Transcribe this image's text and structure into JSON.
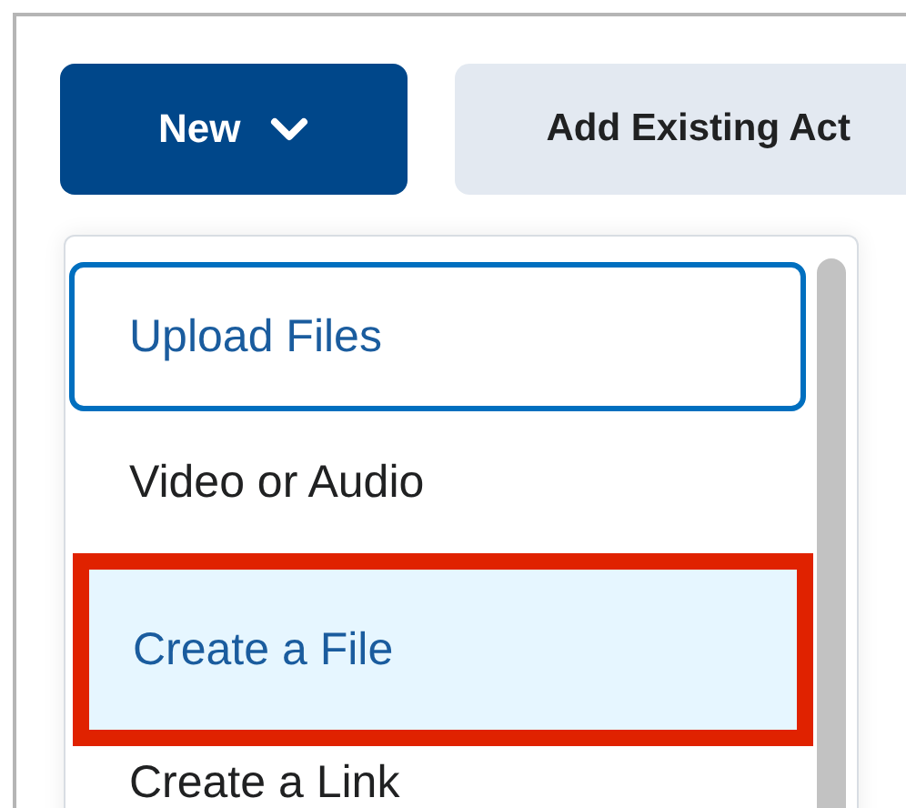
{
  "toolbar": {
    "new_button": {
      "label": "New",
      "expanded": true
    },
    "add_existing_button": {
      "label": "Add Existing Act"
    }
  },
  "menu": {
    "items": [
      {
        "label": "Upload Files",
        "focused": true,
        "selected": false,
        "highlighted": false
      },
      {
        "label": "Video or Audio",
        "focused": false,
        "selected": false,
        "highlighted": false
      },
      {
        "label": "Create a File",
        "focused": false,
        "selected": true,
        "highlighted": true
      },
      {
        "label": "Create a Link",
        "focused": false,
        "selected": false,
        "highlighted": false
      }
    ]
  }
}
